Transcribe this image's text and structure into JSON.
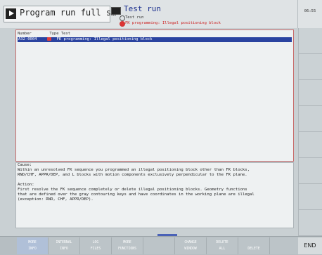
{
  "header": {
    "mode_title": "Program run full s…",
    "sub_title": "Test run",
    "sub_line1": "Test run",
    "sub_line2": "FK programming: Illegal positioning block"
  },
  "clock": "06:55",
  "error_list": {
    "columns": [
      "Number",
      "Type Text"
    ],
    "rows": [
      {
        "number": "A32-0004",
        "text": "FK programming: Illegal positioning block"
      }
    ]
  },
  "details": {
    "cause_heading": "Cause:",
    "cause_lines": [
      "Within an unresolved FK sequence you programmed an illegal positioning block other than FK blocks,",
      "RND/CHF, APPR/DEP, and L blocks with motion components exclusively perpendicular to the FK plane."
    ],
    "action_heading": "Action:",
    "action_lines": [
      "First resolve the FK sequence completely or delete illegal positioning blocks. Geometry functions",
      "that are defined over the gray contouring keys and have coordinates in the working plane are illegal",
      "(exception: RND, CHF, APPR/DEP)."
    ]
  },
  "softkeys": [
    {
      "l1": "MORE",
      "l2": "INFO"
    },
    {
      "l1": "INTERNAL",
      "l2": "INFO"
    },
    {
      "l1": "LOG",
      "l2": "FILES"
    },
    {
      "l1": "MORE",
      "l2": "FUNCTIONS"
    },
    {
      "l1": "",
      "l2": ""
    },
    {
      "l1": "CHANGE",
      "l2": "WINDOW"
    },
    {
      "l1": "DELETE",
      "l2": "ALL"
    },
    {
      "l1": "",
      "l2": "DELETE"
    },
    {
      "l1": "",
      "l2": ""
    }
  ],
  "end_label": "END",
  "colors": {
    "selection": "#2a43a0",
    "error_frame": "#c86b6b",
    "accent": "#4a62b7"
  }
}
